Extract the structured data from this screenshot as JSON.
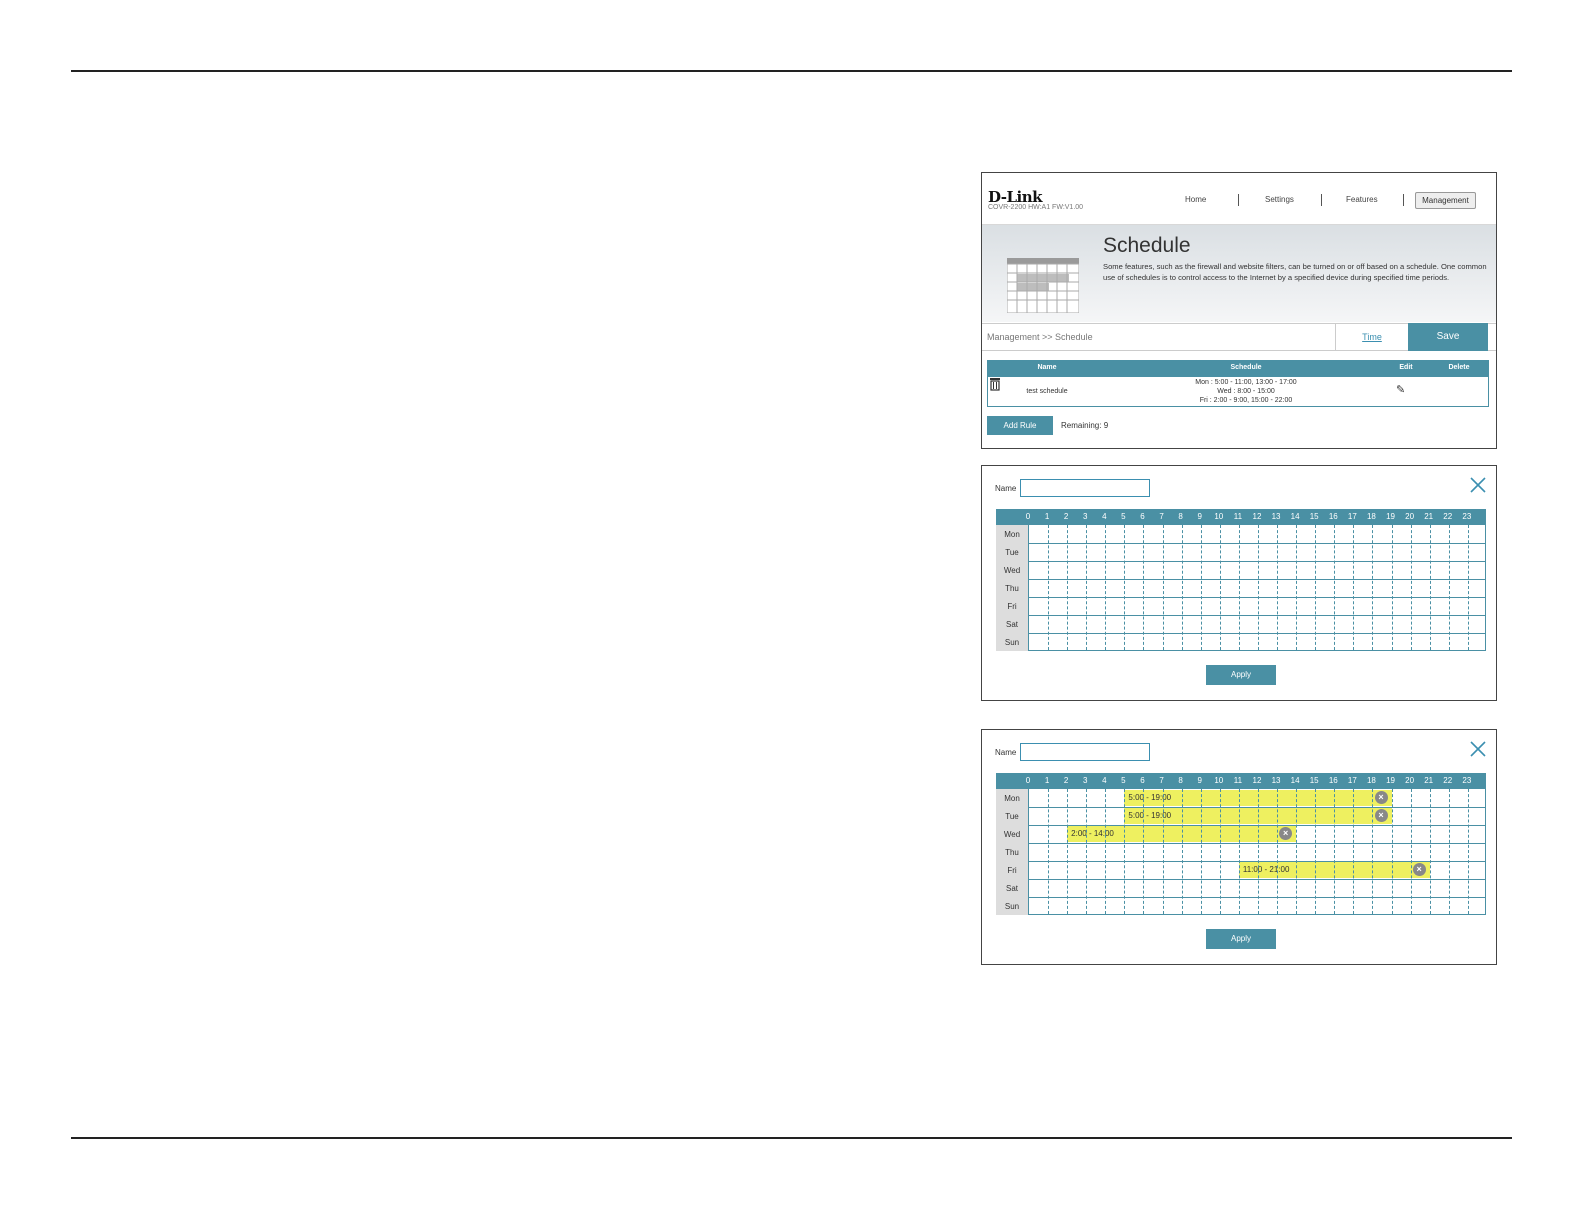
{
  "schedule_page": {
    "logo": "D-Link",
    "model_info": "COVR-2200 HW:A1 FW:V1.00",
    "nav": [
      "Home",
      "Settings",
      "Features",
      "Management"
    ],
    "title": "Schedule",
    "description": "Some features, such as the firewall and website filters, can be turned on or off based on a schedule. One common use of schedules is to control access to the Internet by a specified device during specified time periods.",
    "breadcrumb": "Management >> Schedule",
    "time_link": "Time",
    "save_label": "Save",
    "table": {
      "headers": [
        "Name",
        "Schedule",
        "Edit",
        "Delete"
      ],
      "rows": [
        {
          "name": "test schedule",
          "schedule_lines": [
            "Mon : 5:00 - 11:00, 13:00 - 17:00",
            "Wed : 8:00 - 15:00",
            "Fri : 2:00 - 9:00, 15:00 - 22:00"
          ]
        }
      ]
    },
    "add_rule_label": "Add Rule",
    "remaining": "Remaining: 9"
  },
  "editor": {
    "name_label": "Name",
    "name_value": "",
    "hours": [
      "0",
      "1",
      "2",
      "3",
      "4",
      "5",
      "6",
      "7",
      "8",
      "9",
      "10",
      "11",
      "12",
      "13",
      "14",
      "15",
      "16",
      "17",
      "18",
      "19",
      "20",
      "21",
      "22",
      "23"
    ],
    "days": [
      "Mon",
      "Tue",
      "Wed",
      "Thu",
      "Fri",
      "Sat",
      "Sun"
    ],
    "apply_label": "Apply"
  },
  "editor_filled": {
    "segments": [
      {
        "day": 0,
        "start": 5,
        "end": 19,
        "label": "5:00 - 19:00"
      },
      {
        "day": 1,
        "start": 5,
        "end": 19,
        "label": "5:00 - 19:00"
      },
      {
        "day": 2,
        "start": 2,
        "end": 14,
        "label": "2:00 - 14:00"
      },
      {
        "day": 4,
        "start": 11,
        "end": 21,
        "label": "11:00 - 21:00"
      }
    ]
  },
  "colors": {
    "accent": "#4a90a4",
    "segment": "#eef060",
    "link": "#3b8fb0"
  }
}
